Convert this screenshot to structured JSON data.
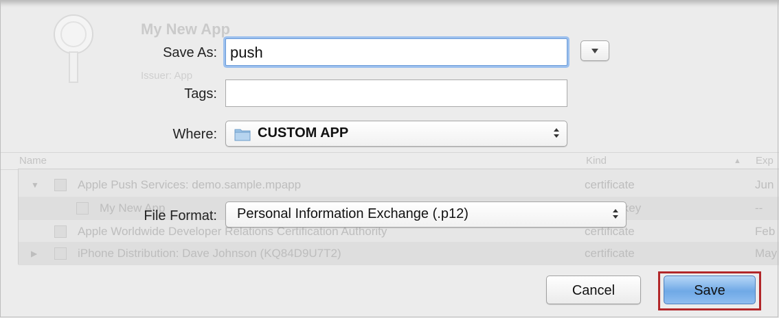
{
  "dialog": {
    "save_as_label": "Save As:",
    "save_as_value": "push",
    "tags_label": "Tags:",
    "tags_value": "",
    "where_label": "Where:",
    "where_value": "CUSTOM APP",
    "file_format_label": "File Format:",
    "file_format_value": "Personal Information Exchange (.p12)",
    "cancel_label": "Cancel",
    "save_label": "Save"
  },
  "background": {
    "title": "My New App",
    "subtitle": "Issuer: App",
    "columns": [
      "Name",
      "Kind",
      "Exp"
    ],
    "rows": [
      {
        "name": "Apple Push Services: demo.sample.mpapp",
        "kind": "certificate",
        "exp": "Jun"
      },
      {
        "name": "My New App",
        "kind": "private key",
        "exp": "--"
      },
      {
        "name": "Apple Worldwide Developer Relations Certification Authority",
        "kind": "certificate",
        "exp": "Feb"
      },
      {
        "name": "iPhone Distribution: Dave Johnson (KQ84D9U7T2)",
        "kind": "certificate",
        "exp": "May"
      }
    ]
  },
  "colors": {
    "highlight": "#b2272a",
    "default_button": "#6fa9e6",
    "focus_ring": "#9cc0ee"
  }
}
